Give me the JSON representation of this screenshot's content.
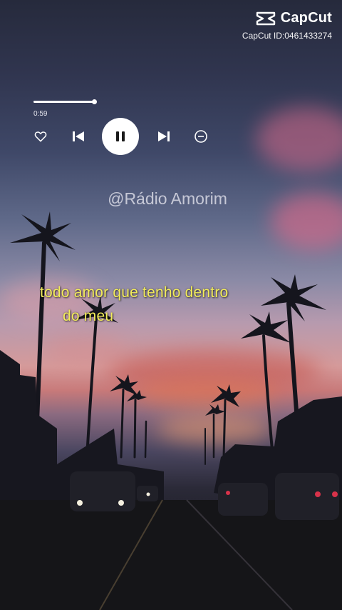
{
  "watermark": {
    "brand": "CapCut",
    "id_text": "CapCut ID:0461433274"
  },
  "player": {
    "elapsed": "0:59",
    "progress": 1.0,
    "controls": [
      "heart-icon",
      "previous-icon",
      "pause-icon",
      "next-icon",
      "minus-circle-icon"
    ]
  },
  "channel": {
    "handle": "@Rádio Amorim"
  },
  "lyrics": {
    "line1": "todo amor que tenho dentro",
    "line2": "do meu"
  },
  "colors": {
    "lyric": "#f2ec5a",
    "control": "#ffffff",
    "play_button_bg": "#ffffff"
  }
}
